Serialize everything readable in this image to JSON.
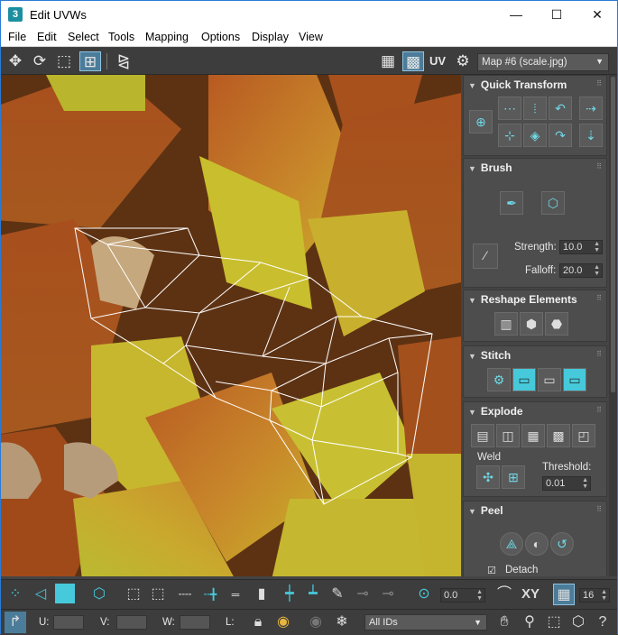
{
  "window": {
    "app_icon": "3",
    "title": "Edit UVWs",
    "controls": {
      "minimize": "—",
      "maximize": "☐",
      "close": "✕"
    }
  },
  "menu": [
    "File",
    "Edit",
    "Select",
    "Tools",
    "Mapping",
    "Options",
    "Display",
    "View"
  ],
  "toolbar": {
    "uv_label": "UV",
    "map_selector": "Map #6 (scale.jpg)"
  },
  "panel": {
    "quick_transform": {
      "title": "Quick Transform"
    },
    "brush": {
      "title": "Brush",
      "strength_label": "Strength:",
      "strength_value": "10.0",
      "falloff_label": "Falloff:",
      "falloff_value": "20.0"
    },
    "reshape": {
      "title": "Reshape Elements"
    },
    "stitch": {
      "title": "Stitch"
    },
    "explode": {
      "title": "Explode",
      "weld_label": "Weld",
      "threshold_label": "Threshold:",
      "threshold_value": "0.01"
    },
    "peel": {
      "title": "Peel",
      "detach_label": "Detach"
    }
  },
  "bottom": {
    "rotate_value": "0.0",
    "xy_label": "XY",
    "grid_value": "16",
    "u_label": "U:",
    "v_label": "V:",
    "w_label": "W:",
    "l_label": "L:",
    "ids_dropdown": "All IDs"
  },
  "colors": {
    "accent": "#46c9da",
    "panel_bg": "#444444",
    "active_button": "#4b7c99",
    "uv_wire": "#ffffff"
  }
}
